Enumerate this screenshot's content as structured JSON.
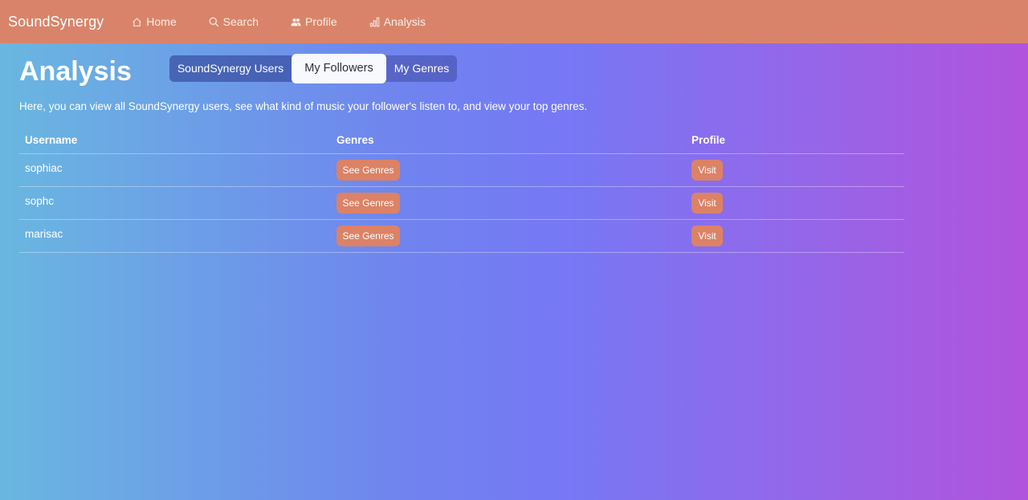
{
  "navbar": {
    "brand": "SoundSynergy",
    "items": [
      {
        "label": "Home",
        "icon": "house-icon"
      },
      {
        "label": "Search",
        "icon": "search-icon"
      },
      {
        "label": "Profile",
        "icon": "people-icon"
      },
      {
        "label": "Analysis",
        "icon": "bar-chart-icon"
      }
    ]
  },
  "page": {
    "title": "Analysis",
    "description": "Here, you can view all SoundSynergy users, see what kind of music your follower's listen to, and view your top genres."
  },
  "tabs": {
    "items": [
      "SoundSynergy Users",
      "My Followers",
      "My Genres"
    ],
    "active": "My Followers"
  },
  "table": {
    "headers": [
      "Username",
      "Genres",
      "Profile"
    ],
    "rows": [
      {
        "username": "sophiac",
        "genres_button": "See Genres",
        "profile_button": "Visit"
      },
      {
        "username": "sophc",
        "genres_button": "See Genres",
        "profile_button": "Visit"
      },
      {
        "username": "marisac",
        "genres_button": "See Genres",
        "profile_button": "Visit"
      }
    ]
  },
  "colors": {
    "navbar": "#d9846a",
    "button": "#dc8266",
    "active_tab": "#f8f9fc"
  }
}
